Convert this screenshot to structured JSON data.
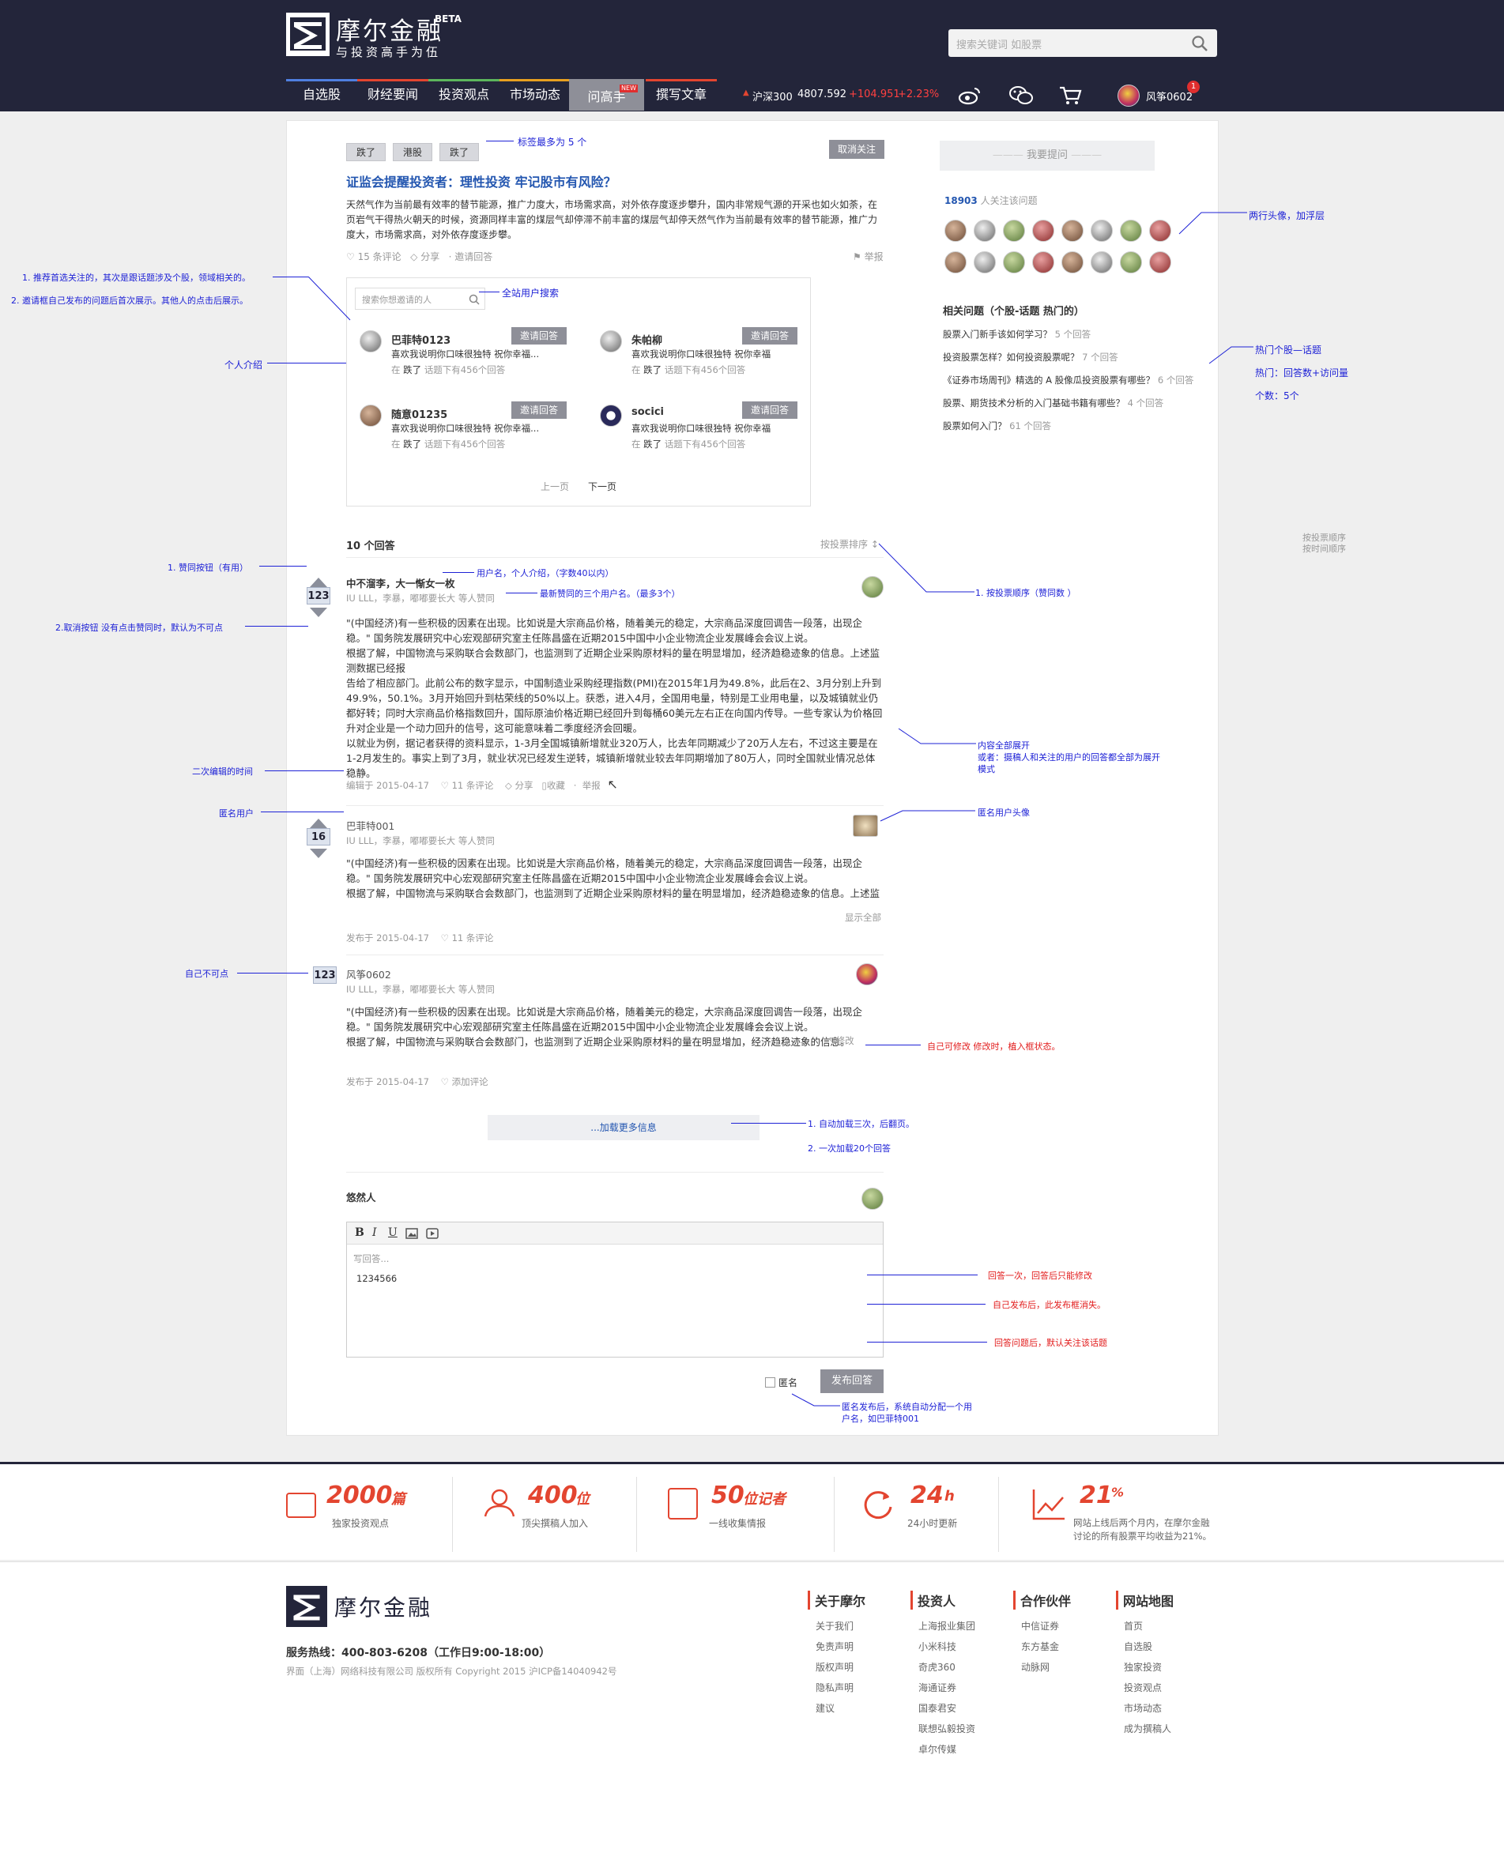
{
  "header": {
    "logo_name": "摩尔金融",
    "logo_beta": "BETA",
    "slogan": "与投资高手为伍",
    "search_placeholder": "搜索关键词 如股票",
    "nav": [
      "自选股",
      "财经要闻",
      "投资观点",
      "市场动态",
      "问高手",
      "撰写文章"
    ],
    "nav_new_badge": "NEW",
    "ticker_name": "沪深300",
    "ticker_value": "4807.592",
    "ticker_change": "+104.951",
    "ticker_pct": "+2.23%",
    "username": "风筝0602",
    "notif_count": "1",
    "colors": {
      "header_bg": "#23253a",
      "accent": "#e34530",
      "up": "#ff4040"
    }
  },
  "question": {
    "tags": [
      "跌了",
      "港股",
      "跌了"
    ],
    "unfollow_label": "取消关注",
    "title": "证监会提醒投资者：理性投资 牢记股市有风险？",
    "body": "天然气作为当前最有效率的替节能源，推广力度大，市场需求高，对外依存度逐步攀升，国内非常规气源的开采也如火如荼，在页岩气干得热火朝天的时候，资源同样丰富的煤层气却停滞不前丰富的煤层气却停天然气作为当前最有效率的替节能源，推广力度大，市场需求高，对外依存度逐步攀。",
    "comments": "15 条评论",
    "share": "分享",
    "invite": "邀请回答",
    "report": "举报"
  },
  "invite_panel": {
    "search_placeholder": "搜索你想邀请的人",
    "btn_label": "邀请回答",
    "users": [
      {
        "name": "巴菲特0123",
        "intro": "喜欢我说明你口味很独特 祝你幸福...",
        "meta_pre": "在",
        "meta_tag": "跌了",
        "meta_post": "话题下有456个回答"
      },
      {
        "name": "朱帕柳",
        "intro": "喜欢我说明你口味很独特 祝你幸福",
        "meta_pre": "在",
        "meta_tag": "跌了",
        "meta_post": "话题下有456个回答"
      },
      {
        "name": "随意01235",
        "intro": "喜欢我说明你口味很独特 祝你幸福...",
        "meta_pre": "在",
        "meta_tag": "跌了",
        "meta_post": "话题下有456个回答"
      },
      {
        "name": "socici",
        "intro": "喜欢我说明你口味很独特 祝你幸福",
        "meta_pre": "在",
        "meta_tag": "跌了",
        "meta_post": "话题下有456个回答"
      }
    ],
    "prev": "上一页",
    "next": "下一页"
  },
  "answers": {
    "count_label": "10 个回答",
    "sort_label": "按投票排序 ↕",
    "items": [
      {
        "votes": "123",
        "author": "中不溜李，大一惭女一枚",
        "supporters": "IU LLL，李暴，嘟嘟要长大 等人赞同",
        "body": "\"(中国经济)有一些积极的因素在出现。比如说是大宗商品价格，随着美元的稳定，大宗商品深度回调告一段落，出现企稳。\" 国务院发展研究中心宏观部研究室主任陈昌盛在近期2015中国中小企业物流企业发展峰会会议上说。\n根据了解，中国物流与采购联合会数部门，也监测到了近期企业采购原材料的量在明显增加，经济趋稳迹象的信息。上述监测数据已经报\n告给了相应部门。此前公布的数字显示，中国制造业采购经理指数(PMI)在2015年1月为49.8%，此后在2、3月分别上升到49.9%，50.1%。3月开始回升到枯荣线的50%以上。获悉，进入4月，全国用电量，特别是工业用电量，以及城镇就业仍都好转；同时大宗商品价格指数回升，国际原油价格近期已经回升到每桶60美元左右正在向国内传导。一些专家认为价格回升对企业是一个动力回升的信号，这可能意味着二季度经济会回暖。\n以就业为例，据记者获得的资料显示，1-3月全国城镇新增就业320万人，比去年同期减少了20万人左右，不过这主要是在1-2月发生的。事实上到了3月，就业状况已经发生逆转，城镇新增就业较去年同期增加了80万人，同时全国就业情况总体稳静。",
        "edited": "编辑于 2015-04-17",
        "comments": "11 条评论",
        "share": "分享",
        "collect": "收藏",
        "report": "举报"
      },
      {
        "votes": "16",
        "author": "巴菲特001",
        "supporters": "IU LLL，李暴，嘟嘟要长大 等人赞同",
        "body": "\"(中国经济)有一些积极的因素在出现。比如说是大宗商品价格，随着美元的稳定，大宗商品深度回调告一段落，出现企稳。\" 国务院发展研究中心宏观部研究室主任陈昌盛在近期2015中国中小企业物流企业发展峰会会议上说。\n根据了解，中国物流与采购联合会数部门，也监测到了近期企业采购原材料的量在明显增加，经济趋稳迹象的信息。上述监测数",
        "show_all": "显示全部",
        "published": "发布于 2015-04-17",
        "comments": "11 条评论"
      },
      {
        "votes": "123",
        "author": "风筝0602",
        "supporters": "IU LLL，李暴，嘟嘟要长大 等人赞同",
        "body": "\"(中国经济)有一些积极的因素在出现。比如说是大宗商品价格，随着美元的稳定，大宗商品深度回调告一段落，出现企稳。\" 国务院发展研究中心宏观部研究室主任陈昌盛在近期2015中国中小企业物流企业发展峰会会议上说。\n根据了解，中国物流与采购联合会数部门，也监测到了近期企业采购原材料的量在明显增加，经济趋稳迹象的信息。",
        "edit": "修改",
        "published": "发布于 2015-04-17",
        "add_comment": "添加评论"
      }
    ],
    "load_more": "...加载更多信息"
  },
  "compose": {
    "username": "悠然人",
    "placeholder": "写回答...",
    "value": "1234566",
    "toolbar": [
      "B",
      "I",
      "U"
    ],
    "anonymous": "匿名",
    "submit": "发布回答"
  },
  "sidebar": {
    "ask_button": "我要提问",
    "followers_count": "18903",
    "followers_label": "人关注该问题",
    "related_title": "相关问题（个股-话题 热门的）",
    "related": [
      {
        "q": "股票入门新手该如何学习？",
        "n": "5 个回答"
      },
      {
        "q": "投资股票怎样？如何投资股票呢？",
        "n": "7 个回答"
      },
      {
        "q": "《证券市场周刊》精选的 A 股像瓜投资股票有哪些？",
        "n": "6 个回答"
      },
      {
        "q": "股票、期货技术分析的入门基础书籍有哪些？",
        "n": "4 个回答"
      },
      {
        "q": "股票如何入门？",
        "n": "61 个回答"
      }
    ]
  },
  "annotations": {
    "tags_max": "标签最多为 5 个",
    "recommend_1": "1. 推荐首选关注的，其次是跟话题涉及个股，领域相关的。",
    "recommend_2": "2. 邀请框自己发布的问题后首次展示。其他人的点击后展示。",
    "site_search": "全站用户搜索",
    "personal_intro": "个人介绍",
    "avatars_2rows": "两行头像，加浮层",
    "hot_1": "热门个股—话题",
    "hot_2": "热门：回答数+访问量",
    "hot_3": "个数：5个",
    "sort_opt_1": "按投票顺序",
    "sort_opt_2": "按时间顺序",
    "like_btn": "1. 赞同按钮（有用）",
    "cancel_btn": "2.取消按钮  没有点击赞同时，默认为不可点",
    "username_intro": "用户名，个人介绍，（字数40以内）",
    "latest_3": "最新赞同的三个用户名。（最多3个）",
    "sort_by_vote": "1. 按投票顺序（赞同数 ）",
    "expand_1": "内容全部展开",
    "expand_2": "或者：摄稿人和关注的用户的回答都全部为展开",
    "expand_3": "模式",
    "edit_time": "二次编辑的时间",
    "anon_user": "匿名用户",
    "anon_avatar": "匿名用户头像",
    "self_not_click": "自己不可点",
    "self_editable": "自己可修改  修改时，植入框状态。",
    "autoload_1": "1. 自动加载三次，后翻页。",
    "autoload_2": "2. 一次加载20个回答",
    "answer_once": "回答一次，回答后只能修改",
    "after_publish": "自己发布后，此发布框消失。",
    "follow_default": "回答问题后，默认关注该话题",
    "anon_1": "匿名发布后，系统自动分配一个用",
    "anon_2": "户名，如巴菲特001"
  },
  "stats": [
    {
      "num": "2000",
      "unit": "篇",
      "label": "独家投资观点"
    },
    {
      "num": "400",
      "unit": "位",
      "label": "顶尖撰稿人加入"
    },
    {
      "num": "50",
      "unit": "位记者",
      "label": "一线收集情报"
    },
    {
      "num": "24",
      "unit": "h",
      "label": "24小时更新"
    },
    {
      "num": "21",
      "unit": "%",
      "label": "网站上线后两个月内，在摩尔金融",
      "label2": "讨论的所有股票平均收益为21%。"
    }
  ],
  "footer": {
    "logo_name": "摩尔金融",
    "hotline_label": "服务热线：",
    "hotline": "400-803-6208（工作日9:00-18:00）",
    "copyright": "界面（上海）网络科技有限公司 版权所有 Copyright 2015 沪ICP备14040942号",
    "cols": [
      {
        "title": "关于摩尔",
        "links": [
          "关于我们",
          "免责声明",
          "版权声明",
          "隐私声明",
          "建议"
        ]
      },
      {
        "title": "投资人",
        "links": [
          "上海报业集团",
          "小米科技",
          "奇虎360",
          "海通证券",
          "国泰君安",
          "联想弘毅投资",
          "卓尔传媒"
        ]
      },
      {
        "title": "合作伙伴",
        "links": [
          "中信证券",
          "东方基金",
          "动脉网"
        ]
      },
      {
        "title": "网站地图",
        "links": [
          "首页",
          "自选股",
          "独家投资",
          "投资观点",
          "市场动态",
          "成为撰稿人"
        ]
      }
    ]
  }
}
